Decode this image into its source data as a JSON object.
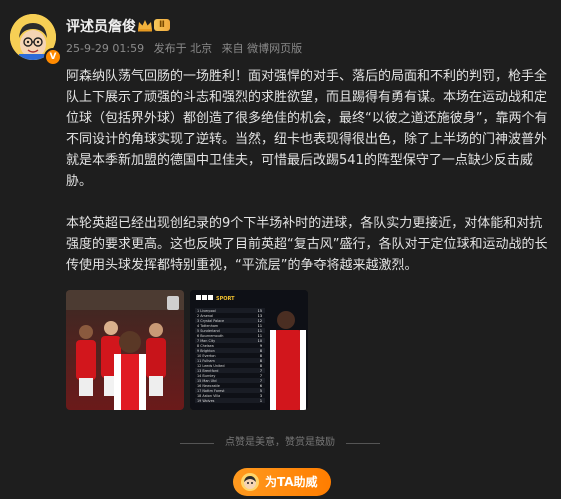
{
  "user": {
    "name": "评述员詹俊",
    "level": "Ⅱ",
    "verified_mark": "V",
    "avatar_icon": "cartoon-avatar-icon"
  },
  "meta": {
    "time": "25-9-29 01:59",
    "location": "发布于 北京",
    "source": "来自 微博网页版"
  },
  "post": {
    "paragraph1": "阿森纳队荡气回肠的一场胜利！面对强悍的对手、落后的局面和不利的判罚，枪手全队上下展示了顽强的斗志和强烈的求胜欲望，而且踢得有勇有谋。本场在运动战和定位球（包括界外球）都创造了很多绝佳的机会，最终“以彼之道还施彼身”，靠两个有不同设计的角球实现了逆转。当然，纽卡也表现得很出色，除了上半场的门神波普外就是本季新加盟的德国中卫佳夫，可惜最后改踢541的阵型保守了一点缺少反击威胁。",
    "paragraph2": "本轮英超已经出现创纪录的9个下半场补时的进球，各队实力更接近，对体能和对抗强度的要求更高。这也反映了目前英超“复古风”盛行，各队对于定位球和运动战的长传使用头球发挥都特别重视，“平流层”的争夺将越来越激烈。"
  },
  "images": {
    "table_brand": "SPORT",
    "table_teams": [
      "Liverpool",
      "Arsenal",
      "Crystal Palace",
      "Tottenham",
      "Sunderland",
      "Bournemouth",
      "Man City",
      "Chelsea",
      "Brighton",
      "Everton",
      "Fulham",
      "Leeds United",
      "Brentford",
      "Burnley",
      "Man Utd",
      "Newcastle",
      "Nottm Forest",
      "Aston Villa",
      "Wolves"
    ],
    "table_points": [
      15,
      13,
      12,
      11,
      11,
      11,
      10,
      9,
      8,
      8,
      8,
      8,
      7,
      7,
      7,
      6,
      5,
      3,
      1
    ]
  },
  "footer": {
    "divider_text": "点赞是美意，赞赏是鼓励",
    "cheer_label": "为TA助威"
  },
  "colors": {
    "background": "#1e1e1e",
    "text": "#e2e2e2",
    "meta": "#8a8a8a",
    "accent": "#ff8a00",
    "arsenal_red": "#d2161c"
  }
}
